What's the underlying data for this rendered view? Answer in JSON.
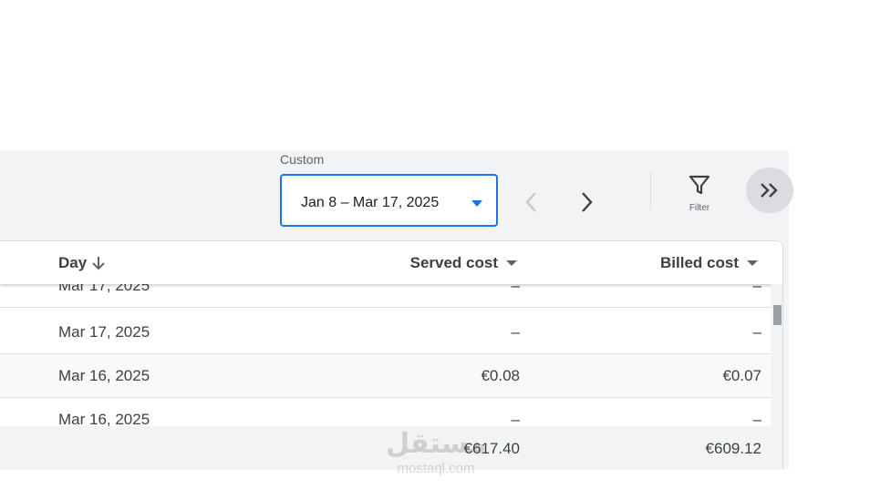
{
  "date_range": {
    "preset_label": "Custom",
    "value": "Jan 8 – Mar 17, 2025"
  },
  "toolbar": {
    "filter_label": "Filter"
  },
  "table": {
    "columns": {
      "day": "Day",
      "served_cost": "Served cost",
      "billed_cost": "Billed cost"
    },
    "rows": [
      {
        "day": "Mar 17, 2025",
        "served": "–",
        "billed": "–"
      },
      {
        "day": "Mar 17, 2025",
        "served": "–",
        "billed": "–"
      },
      {
        "day": "Mar 16, 2025",
        "served": "€0.08",
        "billed": "€0.07"
      },
      {
        "day": "Mar 16, 2025",
        "served": "–",
        "billed": "–"
      }
    ],
    "totals": {
      "served": "€617.40",
      "billed": "€609.12"
    }
  },
  "watermark": {
    "arabic": "مستقل",
    "latin": "mostaql.com"
  },
  "colors": {
    "accent": "#1a73e8",
    "panel": "#f1f3f4"
  }
}
